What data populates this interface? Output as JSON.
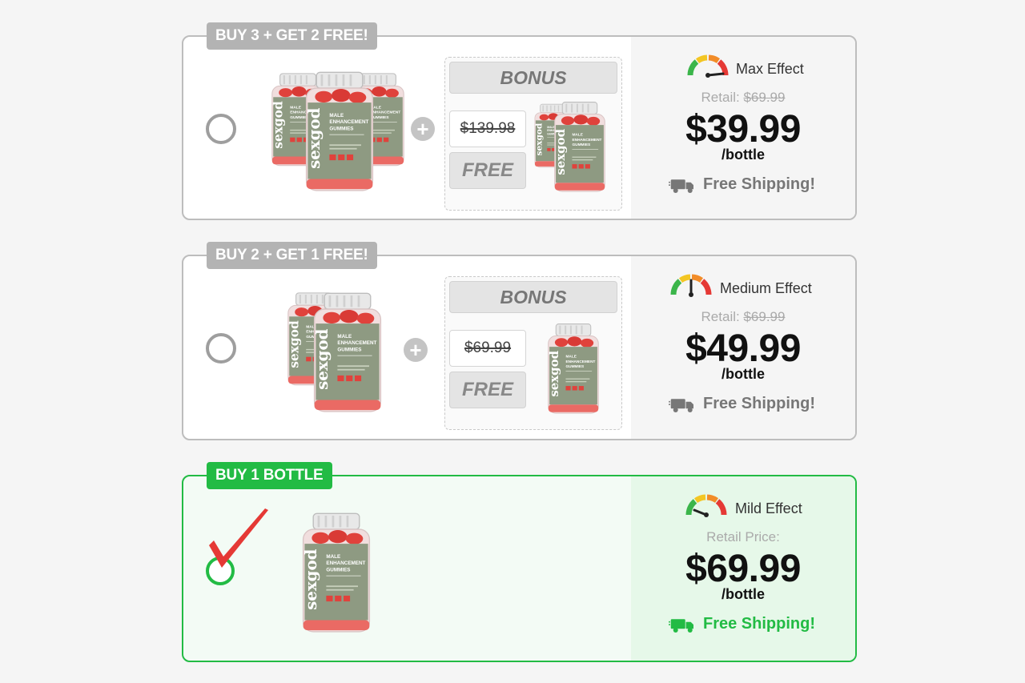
{
  "packages": [
    {
      "badge": "BUY 3 + GET 2 FREE!",
      "bonus_header": "BONUS",
      "bonus_old_price": "$139.98",
      "bonus_free": "FREE",
      "effect": "Max Effect",
      "retail_label": "Retail:",
      "retail_price": "$69.99",
      "price": "$39.99",
      "per": "/bottle",
      "shipping": "Free Shipping!",
      "selected": false
    },
    {
      "badge": "BUY 2 + GET 1 FREE!",
      "bonus_header": "BONUS",
      "bonus_old_price": "$69.99",
      "bonus_free": "FREE",
      "effect": "Medium Effect",
      "retail_label": "Retail:",
      "retail_price": "$69.99",
      "price": "$49.99",
      "per": "/bottle",
      "shipping": "Free Shipping!",
      "selected": false
    },
    {
      "badge": "BUY 1 BOTTLE",
      "effect": "Mild Effect",
      "retail_label": "Retail Price:",
      "price": "$69.99",
      "per": "/bottle",
      "shipping": "Free Shipping!",
      "selected": true
    }
  ],
  "product": {
    "brand": "sexgod",
    "label_line1": "MALE",
    "label_line2": "ENHANCEMENT",
    "label_line3": "GUMMIES"
  },
  "colors": {
    "selected_green": "#22bb44",
    "unselected_gray": "#b3b3b3",
    "check_red": "#e53935",
    "bottle_label": "#8e9a82",
    "gummy_red": "#e0423c"
  },
  "icons": {
    "effect": "speedometer-gauge-icon",
    "shipping": "delivery-truck-icon",
    "add": "plus-icon",
    "selected": "checkmark-icon"
  }
}
